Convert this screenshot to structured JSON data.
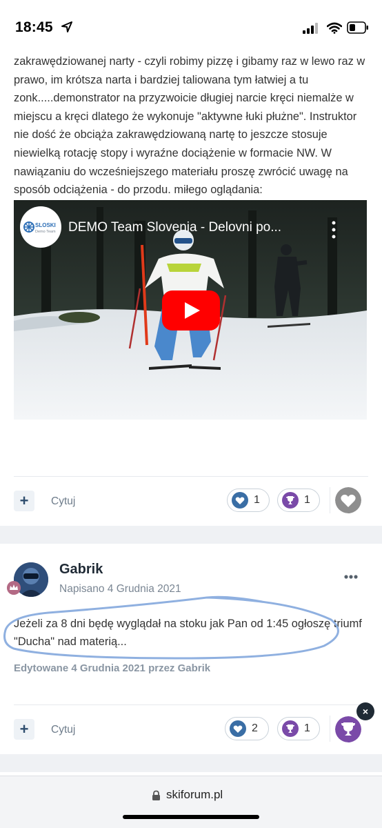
{
  "status_bar": {
    "time": "18:45"
  },
  "post1": {
    "text": "zakrawędziowanej narty - czyli robimy pizzę i gibamy raz w lewo raz w prawo, im krótsza narta i bardziej taliowana tym łatwiej a tu zonk.....demonstrator na przyzwoicie długiej narcie kręci niemalże w miejscu a kręci dlatego że wykonuje \"aktywne łuki płużne\". Instruktor nie dość że obciąża zakrawędziowaną nartę to jeszcze stosuje niewielką rotację stopy i wyraźne dociążenie w formacie NW. W nawiązaniu do wcześniejszego materiału proszę zwrócić uwagę na sposób odciążenia - do przodu. miłego oglądania:",
    "video": {
      "title": "DEMO Team Slovenia - Delovni po...",
      "channel_logo_text": "SLOSKI",
      "channel_logo_subtext": "Demo Team"
    },
    "actions": {
      "plus_label": "+",
      "quote_label": "Cytuj",
      "likes_count": "1",
      "trophy_count": "1"
    }
  },
  "post2": {
    "author": "Gabrik",
    "date": "Napisano 4 Grudnia 2021",
    "text": "Jeżeli za 8 dni będę wyglądał na stoku jak Pan od 1:45 ogłoszę triumf \"Ducha\" nad materią...",
    "edited_note": "Edytowane 4 Grudnia 2021 przez Gabrik",
    "actions": {
      "plus_label": "+",
      "quote_label": "Cytuj",
      "likes_count": "2",
      "trophy_count": "1",
      "close_label": "×"
    }
  },
  "browser": {
    "url": "skiforum.pl"
  },
  "colors": {
    "like": "#3a6ea5",
    "trophy": "#7a4aa8",
    "annotation_stroke": "#8fb0e0",
    "youtube_red": "#ff0000"
  },
  "icons": [
    "location-arrow-icon",
    "signal-icon",
    "wifi-icon",
    "battery-icon",
    "play-icon",
    "more-vertical-icon",
    "heart-icon",
    "trophy-icon",
    "more-horizontal-icon",
    "lock-icon",
    "close-icon"
  ]
}
